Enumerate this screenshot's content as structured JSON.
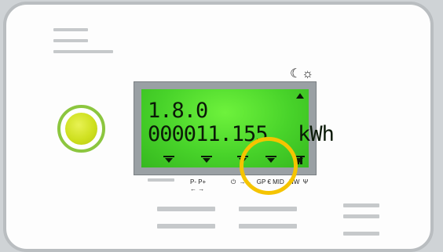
{
  "display": {
    "obis_code": "1.8.0",
    "reading": "000011.155",
    "unit": "kWh"
  },
  "status_icons": "☾☼",
  "labels": {
    "p_minus_plus": "P- P+",
    "arrows": "← →",
    "power": "⏻",
    "items": [
      "GP",
      "€",
      "MID",
      "NW",
      "Ψ"
    ]
  },
  "colors": {
    "lcd_green": "#48d32a",
    "led_ring": "#8cc63f",
    "highlight_ring": "#f5c400"
  }
}
